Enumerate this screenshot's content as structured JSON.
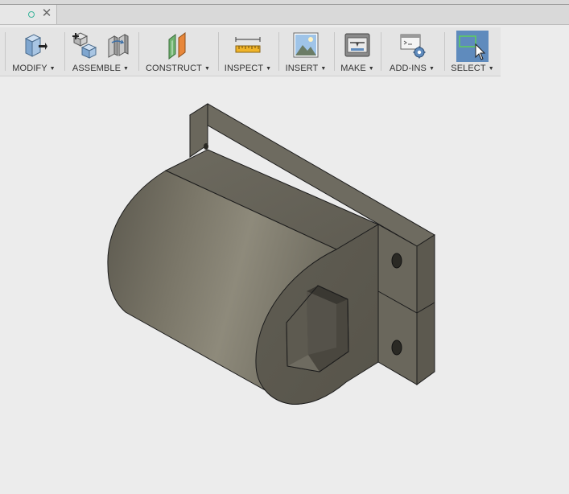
{
  "tab": {
    "status_icon": "circle-outline-icon",
    "close_glyph": "✕"
  },
  "toolbar": {
    "groups": [
      {
        "label": "MODIFY",
        "icon": "press-pull-icon"
      },
      {
        "label": "ASSEMBLE",
        "icon": "new-component-icon"
      },
      {
        "label": "CONSTRUCT",
        "icon": "offset-plane-icon"
      },
      {
        "label": "INSPECT",
        "icon": "measure-ruler-icon"
      },
      {
        "label": "INSERT",
        "icon": "insert-image-icon"
      },
      {
        "label": "MAKE",
        "icon": "3d-print-icon"
      },
      {
        "label": "ADD-INS",
        "icon": "scripts-addins-icon"
      },
      {
        "label": "SELECT",
        "icon": "select-cursor-icon",
        "active": true
      }
    ],
    "dropdown_glyph": "▼",
    "active_color": "#5f8bbd"
  },
  "viewport": {
    "background": "#ececec",
    "model": {
      "name": "hex-socket-bracket",
      "body_color": "#68655a"
    }
  }
}
